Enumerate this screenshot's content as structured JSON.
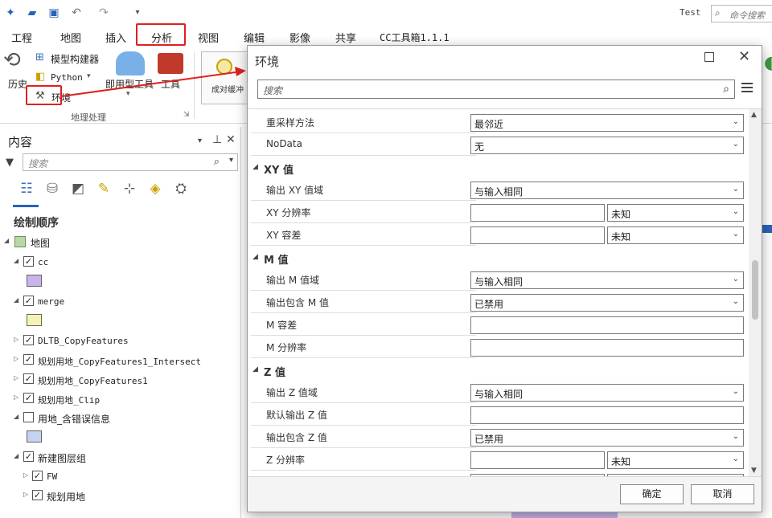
{
  "qat": {
    "user": "Test",
    "command_search_placeholder": "命令搜索"
  },
  "tabs": [
    "工程",
    "地图",
    "插入",
    "分析",
    "视图",
    "编辑",
    "影像",
    "共享",
    "CC工具箱1.1.1"
  ],
  "ribbon": {
    "history": "历史",
    "model_builder": "模型构建器",
    "python": "Python",
    "environments": "环境",
    "ready_tools": "即用型工具",
    "tools": "工具",
    "group_label": "地理处理",
    "partial_item": "成对缓冲"
  },
  "contents": {
    "title": "内容",
    "search_placeholder": "搜索",
    "draw_order": "绘制顺序",
    "layers": [
      {
        "label": "地图",
        "checked": false,
        "mono": false
      },
      {
        "label": "cc",
        "checked": true,
        "mono": true
      },
      {
        "label": "merge",
        "checked": true,
        "mono": true
      },
      {
        "label": "DLTB_CopyFeatures",
        "checked": true,
        "mono": true
      },
      {
        "label": "规划用地_CopyFeatures1_Intersect",
        "checked": true,
        "mono": true
      },
      {
        "label": "规划用地_CopyFeatures1",
        "checked": true,
        "mono": true
      },
      {
        "label": "规划用地_Clip",
        "checked": true,
        "mono": true
      },
      {
        "label": "用地_含错误信息",
        "checked": false,
        "mono": false
      },
      {
        "label": "新建图层组",
        "checked": true,
        "mono": false
      },
      {
        "label": "FW",
        "checked": true,
        "mono": true
      },
      {
        "label": "规划用地",
        "checked": true,
        "mono": false
      }
    ],
    "swatch_colors": {
      "cc": "#c9b3ea",
      "merge": "#f4f3b2",
      "error": "#c6d3f0"
    }
  },
  "dialog": {
    "title": "环境",
    "search_placeholder": "搜索",
    "ok": "确定",
    "cancel": "取消",
    "rows": {
      "resample": {
        "label": "重采样方法",
        "value": "最邻近"
      },
      "nodata": {
        "label": "NoData",
        "value": "无"
      },
      "xy_section": "XY 值",
      "xy_domain": {
        "label": "输出 XY 值域",
        "value": "与输入相同"
      },
      "xy_resolution": {
        "label": "XY 分辨率",
        "unit": "未知"
      },
      "xy_tolerance": {
        "label": "XY 容差",
        "unit": "未知"
      },
      "m_section": "M 值",
      "m_domain": {
        "label": "输出 M 值域",
        "value": "与输入相同"
      },
      "m_include": {
        "label": "输出包含 M 值",
        "value": "已禁用"
      },
      "m_tolerance": {
        "label": "M 容差"
      },
      "m_resolution": {
        "label": "M 分辨率"
      },
      "z_section": "Z 值",
      "z_domain": {
        "label": "输出 Z 值域",
        "value": "与输入相同"
      },
      "z_default": {
        "label": "默认输出 Z 值"
      },
      "z_include": {
        "label": "输出包含 Z 值",
        "value": "已禁用"
      },
      "z_resolution": {
        "label": "Z 分辨率",
        "unit": "未知"
      }
    }
  }
}
